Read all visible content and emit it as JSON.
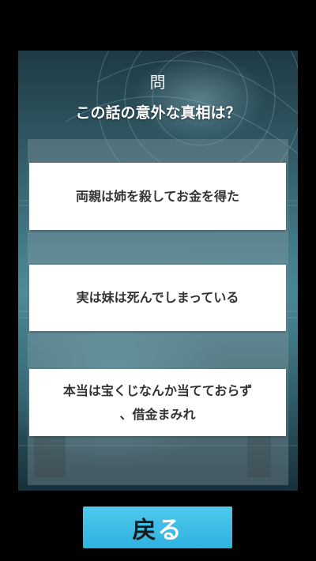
{
  "quiz": {
    "question_marker": "問",
    "question": "この話の意外な真相は？",
    "answers": [
      {
        "label": "両親は姉を殺してお金を得た"
      },
      {
        "label": "実は妹は死んでしまっている"
      },
      {
        "label_line1": "本当は宝くじなんか当てておらず",
        "label_line2": "、借金まみれ"
      }
    ]
  },
  "footer": {
    "back_label_kanji": "戻",
    "back_label_kana": "る"
  },
  "colors": {
    "button_accent": "#3ab9e4",
    "panel_teal": "#4e8c98",
    "answer_bg": "#ffffff",
    "answer_text": "#333333"
  }
}
